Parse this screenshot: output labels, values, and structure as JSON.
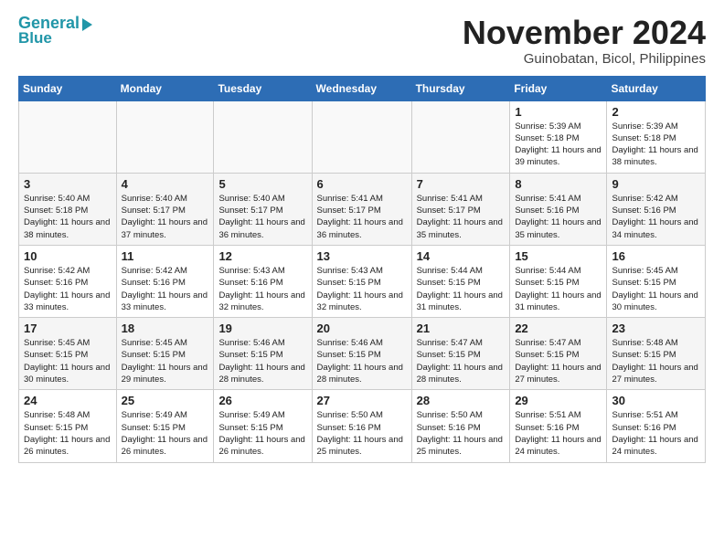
{
  "logo": {
    "line1": "General",
    "line2": "Blue"
  },
  "title": "November 2024",
  "location": "Guinobatan, Bicol, Philippines",
  "weekdays": [
    "Sunday",
    "Monday",
    "Tuesday",
    "Wednesday",
    "Thursday",
    "Friday",
    "Saturday"
  ],
  "weeks": [
    [
      {
        "day": "",
        "info": ""
      },
      {
        "day": "",
        "info": ""
      },
      {
        "day": "",
        "info": ""
      },
      {
        "day": "",
        "info": ""
      },
      {
        "day": "",
        "info": ""
      },
      {
        "day": "1",
        "info": "Sunrise: 5:39 AM\nSunset: 5:18 PM\nDaylight: 11 hours and 39 minutes."
      },
      {
        "day": "2",
        "info": "Sunrise: 5:39 AM\nSunset: 5:18 PM\nDaylight: 11 hours and 38 minutes."
      }
    ],
    [
      {
        "day": "3",
        "info": "Sunrise: 5:40 AM\nSunset: 5:18 PM\nDaylight: 11 hours and 38 minutes."
      },
      {
        "day": "4",
        "info": "Sunrise: 5:40 AM\nSunset: 5:17 PM\nDaylight: 11 hours and 37 minutes."
      },
      {
        "day": "5",
        "info": "Sunrise: 5:40 AM\nSunset: 5:17 PM\nDaylight: 11 hours and 36 minutes."
      },
      {
        "day": "6",
        "info": "Sunrise: 5:41 AM\nSunset: 5:17 PM\nDaylight: 11 hours and 36 minutes."
      },
      {
        "day": "7",
        "info": "Sunrise: 5:41 AM\nSunset: 5:17 PM\nDaylight: 11 hours and 35 minutes."
      },
      {
        "day": "8",
        "info": "Sunrise: 5:41 AM\nSunset: 5:16 PM\nDaylight: 11 hours and 35 minutes."
      },
      {
        "day": "9",
        "info": "Sunrise: 5:42 AM\nSunset: 5:16 PM\nDaylight: 11 hours and 34 minutes."
      }
    ],
    [
      {
        "day": "10",
        "info": "Sunrise: 5:42 AM\nSunset: 5:16 PM\nDaylight: 11 hours and 33 minutes."
      },
      {
        "day": "11",
        "info": "Sunrise: 5:42 AM\nSunset: 5:16 PM\nDaylight: 11 hours and 33 minutes."
      },
      {
        "day": "12",
        "info": "Sunrise: 5:43 AM\nSunset: 5:16 PM\nDaylight: 11 hours and 32 minutes."
      },
      {
        "day": "13",
        "info": "Sunrise: 5:43 AM\nSunset: 5:15 PM\nDaylight: 11 hours and 32 minutes."
      },
      {
        "day": "14",
        "info": "Sunrise: 5:44 AM\nSunset: 5:15 PM\nDaylight: 11 hours and 31 minutes."
      },
      {
        "day": "15",
        "info": "Sunrise: 5:44 AM\nSunset: 5:15 PM\nDaylight: 11 hours and 31 minutes."
      },
      {
        "day": "16",
        "info": "Sunrise: 5:45 AM\nSunset: 5:15 PM\nDaylight: 11 hours and 30 minutes."
      }
    ],
    [
      {
        "day": "17",
        "info": "Sunrise: 5:45 AM\nSunset: 5:15 PM\nDaylight: 11 hours and 30 minutes."
      },
      {
        "day": "18",
        "info": "Sunrise: 5:45 AM\nSunset: 5:15 PM\nDaylight: 11 hours and 29 minutes."
      },
      {
        "day": "19",
        "info": "Sunrise: 5:46 AM\nSunset: 5:15 PM\nDaylight: 11 hours and 28 minutes."
      },
      {
        "day": "20",
        "info": "Sunrise: 5:46 AM\nSunset: 5:15 PM\nDaylight: 11 hours and 28 minutes."
      },
      {
        "day": "21",
        "info": "Sunrise: 5:47 AM\nSunset: 5:15 PM\nDaylight: 11 hours and 28 minutes."
      },
      {
        "day": "22",
        "info": "Sunrise: 5:47 AM\nSunset: 5:15 PM\nDaylight: 11 hours and 27 minutes."
      },
      {
        "day": "23",
        "info": "Sunrise: 5:48 AM\nSunset: 5:15 PM\nDaylight: 11 hours and 27 minutes."
      }
    ],
    [
      {
        "day": "24",
        "info": "Sunrise: 5:48 AM\nSunset: 5:15 PM\nDaylight: 11 hours and 26 minutes."
      },
      {
        "day": "25",
        "info": "Sunrise: 5:49 AM\nSunset: 5:15 PM\nDaylight: 11 hours and 26 minutes."
      },
      {
        "day": "26",
        "info": "Sunrise: 5:49 AM\nSunset: 5:15 PM\nDaylight: 11 hours and 26 minutes."
      },
      {
        "day": "27",
        "info": "Sunrise: 5:50 AM\nSunset: 5:16 PM\nDaylight: 11 hours and 25 minutes."
      },
      {
        "day": "28",
        "info": "Sunrise: 5:50 AM\nSunset: 5:16 PM\nDaylight: 11 hours and 25 minutes."
      },
      {
        "day": "29",
        "info": "Sunrise: 5:51 AM\nSunset: 5:16 PM\nDaylight: 11 hours and 24 minutes."
      },
      {
        "day": "30",
        "info": "Sunrise: 5:51 AM\nSunset: 5:16 PM\nDaylight: 11 hours and 24 minutes."
      }
    ]
  ]
}
